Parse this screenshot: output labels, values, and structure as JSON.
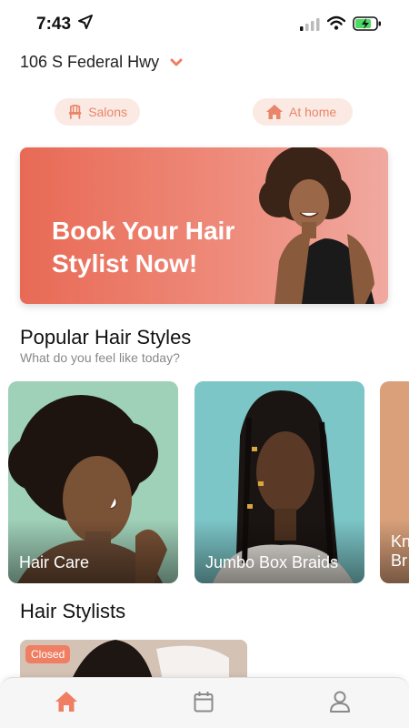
{
  "status_bar": {
    "time": "7:43"
  },
  "location": {
    "address": "106 S Federal Hwy"
  },
  "toggles": [
    {
      "label": "Salons",
      "icon": "chair-icon"
    },
    {
      "label": "At home",
      "icon": "house-icon"
    }
  ],
  "banner": {
    "headline": "Book Your Hair Stylist Now!"
  },
  "popular": {
    "title": "Popular Hair Styles",
    "subtitle": "What do you feel like today?",
    "cards": [
      {
        "label": "Hair Care"
      },
      {
        "label": "Jumbo Box Braids"
      },
      {
        "label": "Kn Br"
      }
    ]
  },
  "stylists": {
    "title": "Hair Stylists",
    "items": [
      {
        "badge": "Closed"
      }
    ]
  },
  "tabbar": {
    "items": [
      {
        "icon": "home-icon",
        "active": true
      },
      {
        "icon": "calendar-icon",
        "active": false
      },
      {
        "icon": "profile-icon",
        "active": false
      }
    ]
  },
  "colors": {
    "accent": "#ef7e63",
    "pill_bg": "#fbe9e3",
    "banner_start": "#e86a55",
    "banner_end": "#f0a9a0"
  }
}
